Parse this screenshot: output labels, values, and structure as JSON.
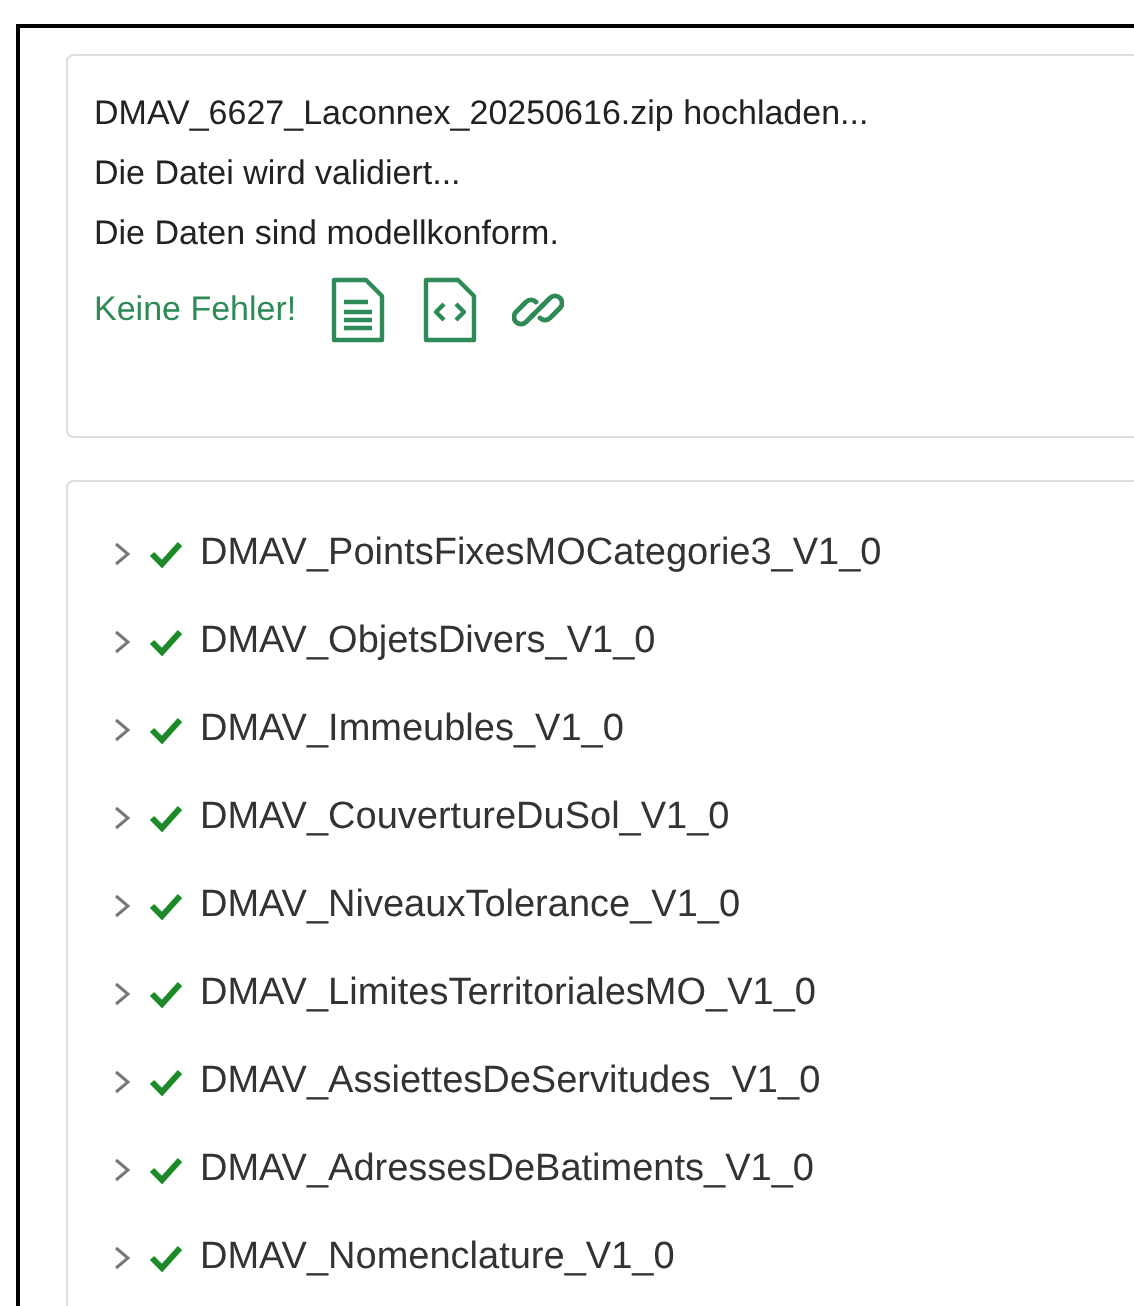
{
  "upload_log": {
    "lines": [
      "DMAV_6627_Laconnex_20250616.zip hochladen...",
      "Die Datei wird validiert...",
      "Die Daten sind modellkonform."
    ],
    "result": "Keine Fehler!"
  },
  "models": [
    {
      "name": "DMAV_PointsFixesMOCategorie3_V1_0",
      "expanded": false,
      "valid": true
    },
    {
      "name": "DMAV_ObjetsDivers_V1_0",
      "expanded": false,
      "valid": true
    },
    {
      "name": "DMAV_Immeubles_V1_0",
      "expanded": false,
      "valid": true
    },
    {
      "name": "DMAV_CouvertureDuSol_V1_0",
      "expanded": false,
      "valid": true
    },
    {
      "name": "DMAV_NiveauxTolerance_V1_0",
      "expanded": false,
      "valid": true
    },
    {
      "name": "DMAV_LimitesTerritorialesMO_V1_0",
      "expanded": false,
      "valid": true
    },
    {
      "name": "DMAV_AssiettesDeServitudes_V1_0",
      "expanded": false,
      "valid": true
    },
    {
      "name": "DMAV_AdressesDeBatiments_V1_0",
      "expanded": false,
      "valid": true
    },
    {
      "name": "DMAV_Nomenclature_V1_0",
      "expanded": false,
      "valid": true
    }
  ]
}
